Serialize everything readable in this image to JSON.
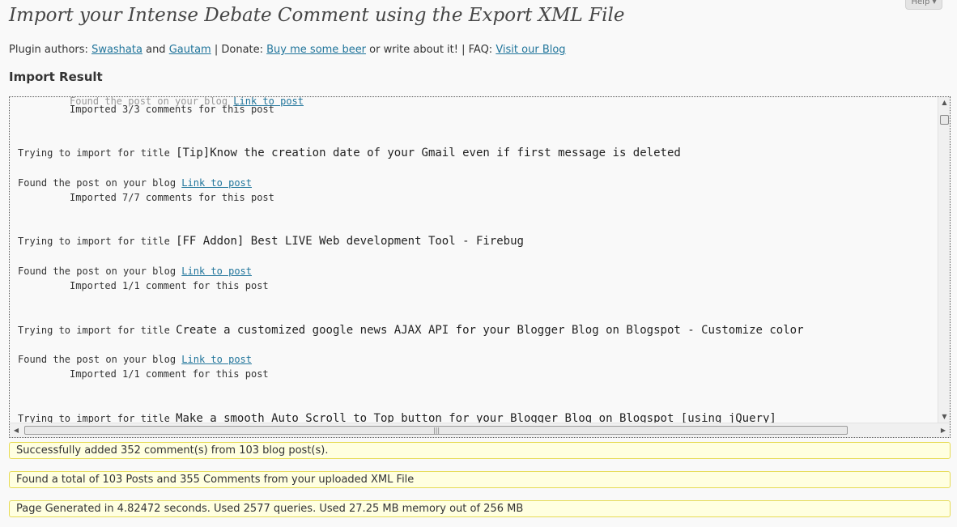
{
  "help": {
    "label": "Help ▾"
  },
  "header": {
    "title": "Import your Intense Debate Comment using the Export XML File"
  },
  "credits": {
    "prefix": "Plugin authors: ",
    "author1": "Swashata",
    "and": " and ",
    "author2": "Gautam",
    "donate_prefix": " | Donate: ",
    "donate_link": "Buy me some beer",
    "donate_suffix": " or write about it! | FAQ: ",
    "faq_link": "Visit our Blog"
  },
  "result": {
    "heading": "Import Result",
    "partial_top": "Imported 3/3 comments for this post",
    "try_prefix": "Trying to import for title ",
    "found_prefix": "Found the post on your blog ",
    "link_text": "Link to post",
    "entries": [
      {
        "title": "[Tip]Know the creation date of your Gmail even if first message is deleted",
        "imported": "Imported 7/7 comments for this post"
      },
      {
        "title": "[FF Addon] Best LIVE Web development Tool - Firebug",
        "imported": "Imported 1/1 comment for this post"
      },
      {
        "title": "Create a customized google news AJAX API for your Blogger Blog on Blogspot - Customize color",
        "imported": "Imported 1/1 comment for this post"
      },
      {
        "title": "Make a smooth Auto Scroll to Top button for your Blogger Blog on Blogspot [using jQuery]",
        "imported": ""
      }
    ]
  },
  "notices": {
    "added": "Successfully added 352 comment(s) from 103 blog post(s).",
    "found": "Found a total of 103 Posts and 355 Comments from your uploaded XML File",
    "stats": "Page Generated in 4.82472 seconds. Used 2577 queries. Used 27.25 MB memory out of 256 MB"
  },
  "icons": {
    "scroll_up": "arrow-up-icon",
    "scroll_down": "arrow-down-icon",
    "scroll_left": "arrow-left-icon",
    "scroll_right": "arrow-right-icon"
  }
}
